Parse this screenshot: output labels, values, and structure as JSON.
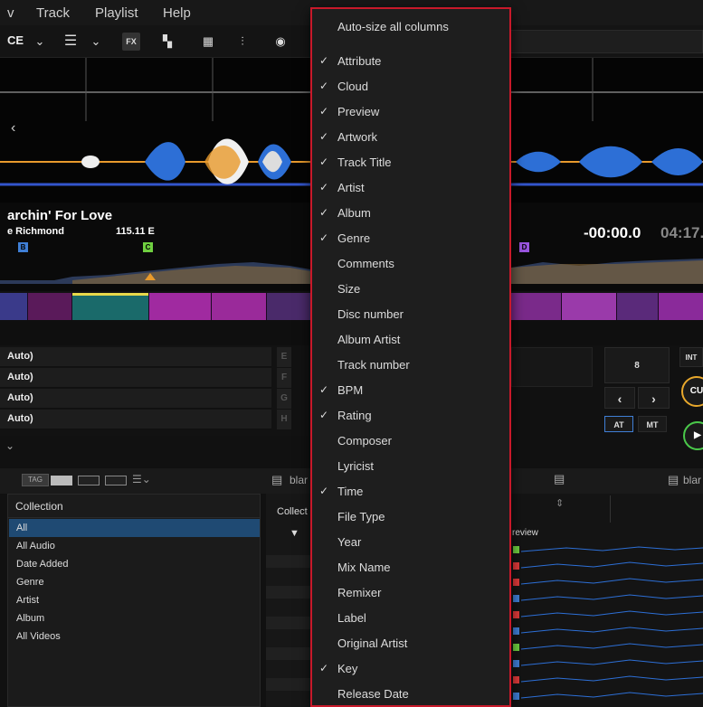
{
  "menubar": {
    "items": [
      "v",
      "Track",
      "Playlist",
      "Help"
    ]
  },
  "toolbar": {
    "deck_label": "CE",
    "fx_label": "FX"
  },
  "track": {
    "title": "archin' For Love",
    "artist": "e Richmond",
    "bpm_key": "115.11 E",
    "time_elapsed": "-00:00.0",
    "time_total": "04:17."
  },
  "hotcue_markers": [
    "B",
    "C",
    "D"
  ],
  "pads": {
    "rows": [
      "Auto)",
      "Auto)",
      "Auto)",
      "Auto)"
    ],
    "letters": [
      "E",
      "F",
      "G",
      "H"
    ]
  },
  "deck_controls": {
    "beat_value": "8",
    "int_label": "INT",
    "prev": "‹",
    "next": "›",
    "at": "AT",
    "mt": "MT",
    "cue": "CU"
  },
  "browser": {
    "tab_left": "blar",
    "tab_right": "blar",
    "col_collection": "Collect",
    "col_preview": "review"
  },
  "sidebar": {
    "header": "Collection",
    "items": [
      "All",
      "All Audio",
      "Date Added",
      "Genre",
      "Artist",
      "Album",
      "All Videos"
    ]
  },
  "context_menu": {
    "items": [
      {
        "label": "Auto-size all columns",
        "checked": false
      },
      {
        "label": "Attribute",
        "checked": true
      },
      {
        "label": "Cloud",
        "checked": true
      },
      {
        "label": "Preview",
        "checked": true
      },
      {
        "label": "Artwork",
        "checked": true
      },
      {
        "label": "Track Title",
        "checked": true
      },
      {
        "label": "Artist",
        "checked": true
      },
      {
        "label": "Album",
        "checked": true
      },
      {
        "label": "Genre",
        "checked": true
      },
      {
        "label": "Comments",
        "checked": false
      },
      {
        "label": "Size",
        "checked": false
      },
      {
        "label": "Disc number",
        "checked": false
      },
      {
        "label": "Album Artist",
        "checked": false
      },
      {
        "label": "Track number",
        "checked": false
      },
      {
        "label": "BPM",
        "checked": true
      },
      {
        "label": "Rating",
        "checked": true
      },
      {
        "label": "Composer",
        "checked": false
      },
      {
        "label": "Lyricist",
        "checked": false
      },
      {
        "label": "Time",
        "checked": true
      },
      {
        "label": "File Type",
        "checked": false
      },
      {
        "label": "Year",
        "checked": false
      },
      {
        "label": "Mix Name",
        "checked": false
      },
      {
        "label": "Remixer",
        "checked": false
      },
      {
        "label": "Label",
        "checked": false
      },
      {
        "label": "Original Artist",
        "checked": false
      },
      {
        "label": "Key",
        "checked": true
      },
      {
        "label": "Release Date",
        "checked": false
      }
    ]
  },
  "colors": {
    "accent": "#c8192a",
    "selected": "#1f4a73",
    "wave_blue": "#2d6fd6",
    "wave_orange": "#e89a2c"
  }
}
